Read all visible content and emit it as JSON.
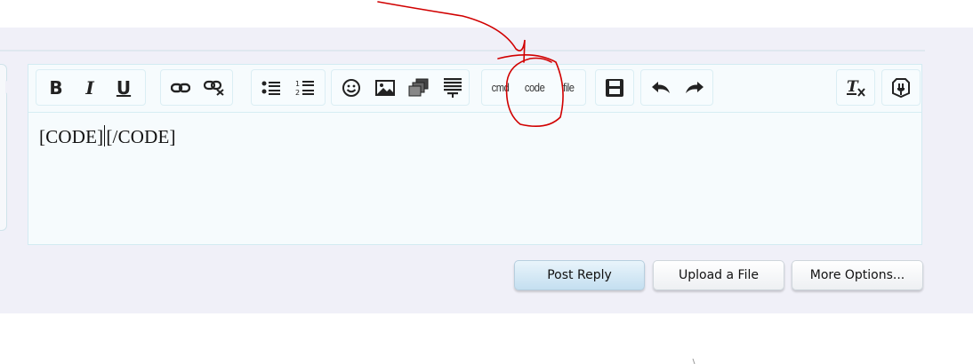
{
  "editor": {
    "content_parts": [
      "[CODE]",
      "[/CODE]"
    ]
  },
  "toolbar": {
    "text_buttons": {
      "cmd": "cmd",
      "code": "code",
      "file": "file"
    },
    "icons": {
      "bold": "B",
      "italic": "I",
      "underline": "U"
    }
  },
  "actions": {
    "post_reply": "Post Reply",
    "upload_file": "Upload a File",
    "more_options": "More Options..."
  },
  "colors": {
    "panel_bg": "#f0f0f8",
    "editor_bg": "#f6fbfd",
    "annotation": "#d10000"
  }
}
